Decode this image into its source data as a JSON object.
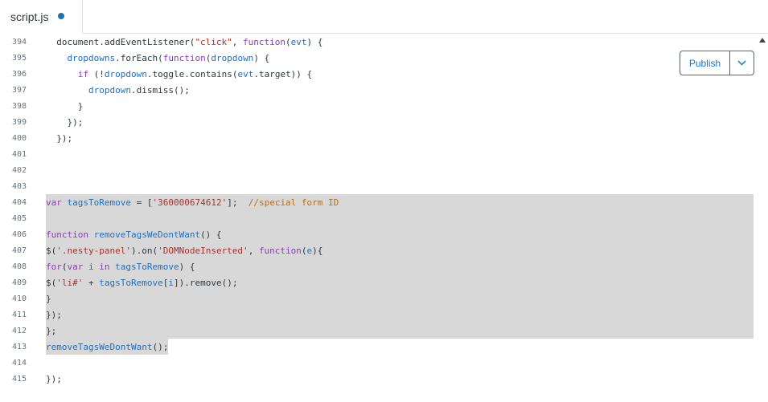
{
  "tab": {
    "label": "script.js",
    "unsaved": true
  },
  "publish": {
    "label": "Publish"
  },
  "colors": {
    "accent": "#1f73b7",
    "selection": "#d8d8d8"
  },
  "lines": [
    {
      "n": "394",
      "tokens": [
        {
          "t": "  document.addEventListener(",
          "c": ""
        },
        {
          "t": "\"click\"",
          "c": "str"
        },
        {
          "t": ", ",
          "c": ""
        },
        {
          "t": "function",
          "c": "kw"
        },
        {
          "t": "(",
          "c": ""
        },
        {
          "t": "evt",
          "c": "id"
        },
        {
          "t": ") {",
          "c": ""
        }
      ]
    },
    {
      "n": "395",
      "tokens": [
        {
          "t": "    ",
          "c": ""
        },
        {
          "t": "dropdowns",
          "c": "id"
        },
        {
          "t": ".forEach(",
          "c": ""
        },
        {
          "t": "function",
          "c": "kw"
        },
        {
          "t": "(",
          "c": ""
        },
        {
          "t": "dropdown",
          "c": "id"
        },
        {
          "t": ") {",
          "c": ""
        }
      ]
    },
    {
      "n": "396",
      "tokens": [
        {
          "t": "      ",
          "c": ""
        },
        {
          "t": "if",
          "c": "kw"
        },
        {
          "t": " (!",
          "c": ""
        },
        {
          "t": "dropdown",
          "c": "id"
        },
        {
          "t": ".toggle.contains(",
          "c": ""
        },
        {
          "t": "evt",
          "c": "id"
        },
        {
          "t": ".target)) {",
          "c": ""
        }
      ]
    },
    {
      "n": "397",
      "tokens": [
        {
          "t": "        ",
          "c": ""
        },
        {
          "t": "dropdown",
          "c": "id"
        },
        {
          "t": ".dismiss();",
          "c": ""
        }
      ]
    },
    {
      "n": "398",
      "tokens": [
        {
          "t": "      }",
          "c": ""
        }
      ]
    },
    {
      "n": "399",
      "tokens": [
        {
          "t": "    });",
          "c": ""
        }
      ]
    },
    {
      "n": "400",
      "tokens": [
        {
          "t": "  });",
          "c": ""
        }
      ]
    },
    {
      "n": "401",
      "tokens": []
    },
    {
      "n": "402",
      "tokens": []
    },
    {
      "n": "403",
      "tokens": []
    },
    {
      "n": "404",
      "tokens": [
        {
          "t": "var",
          "c": "kw"
        },
        {
          "t": " ",
          "c": ""
        },
        {
          "t": "tagsToRemove",
          "c": "id"
        },
        {
          "t": " = [",
          "c": ""
        },
        {
          "t": "'360000674612'",
          "c": "str"
        },
        {
          "t": "];  ",
          "c": ""
        },
        {
          "t": "//special form ID",
          "c": "cm"
        }
      ]
    },
    {
      "n": "405",
      "tokens": []
    },
    {
      "n": "406",
      "tokens": [
        {
          "t": "function",
          "c": "kw"
        },
        {
          "t": " ",
          "c": ""
        },
        {
          "t": "removeTagsWeDontWant",
          "c": "id"
        },
        {
          "t": "() {",
          "c": ""
        }
      ]
    },
    {
      "n": "407",
      "tokens": [
        {
          "t": "$(",
          "c": ""
        },
        {
          "t": "'.nesty-panel'",
          "c": "str"
        },
        {
          "t": ").on(",
          "c": ""
        },
        {
          "t": "'DOMNodeInserted'",
          "c": "str"
        },
        {
          "t": ", ",
          "c": ""
        },
        {
          "t": "function",
          "c": "kw"
        },
        {
          "t": "(",
          "c": ""
        },
        {
          "t": "e",
          "c": "id"
        },
        {
          "t": "){",
          "c": ""
        }
      ]
    },
    {
      "n": "408",
      "tokens": [
        {
          "t": "for",
          "c": "kw"
        },
        {
          "t": "(",
          "c": ""
        },
        {
          "t": "var",
          "c": "kw"
        },
        {
          "t": " ",
          "c": ""
        },
        {
          "t": "i",
          "c": "id"
        },
        {
          "t": " ",
          "c": ""
        },
        {
          "t": "in",
          "c": "kw"
        },
        {
          "t": " ",
          "c": ""
        },
        {
          "t": "tagsToRemove",
          "c": "id"
        },
        {
          "t": ") {",
          "c": ""
        }
      ]
    },
    {
      "n": "409",
      "tokens": [
        {
          "t": "$(",
          "c": ""
        },
        {
          "t": "'li#'",
          "c": "str"
        },
        {
          "t": " + ",
          "c": ""
        },
        {
          "t": "tagsToRemove",
          "c": "id"
        },
        {
          "t": "[",
          "c": ""
        },
        {
          "t": "i",
          "c": "id"
        },
        {
          "t": "]).remove();",
          "c": ""
        }
      ]
    },
    {
      "n": "410",
      "tokens": [
        {
          "t": "}",
          "c": ""
        }
      ]
    },
    {
      "n": "411",
      "tokens": [
        {
          "t": "});",
          "c": ""
        }
      ]
    },
    {
      "n": "412",
      "tokens": [
        {
          "t": "};",
          "c": ""
        }
      ]
    },
    {
      "n": "413",
      "tokens": [
        {
          "t": "removeTagsWeDontWant",
          "c": "id"
        },
        {
          "t": "();",
          "c": ""
        }
      ]
    },
    {
      "n": "414",
      "tokens": []
    },
    {
      "n": "415",
      "tokens": [
        {
          "t": "});",
          "c": ""
        }
      ]
    }
  ]
}
